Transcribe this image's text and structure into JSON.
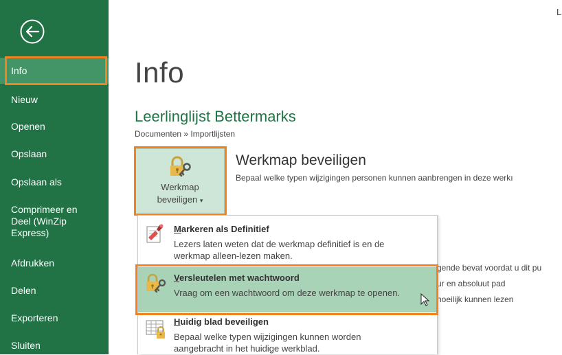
{
  "sidebar": {
    "items": [
      {
        "label": "Info"
      },
      {
        "label": "Nieuw"
      },
      {
        "label": "Openen"
      },
      {
        "label": "Opslaan"
      },
      {
        "label": "Opslaan als"
      },
      {
        "label": "Comprimeer en Deel (WinZip Express)"
      },
      {
        "label": "Afdrukken"
      },
      {
        "label": "Delen"
      },
      {
        "label": "Exporteren"
      },
      {
        "label": "Sluiten"
      }
    ]
  },
  "header": {
    "corner_letter": "L"
  },
  "main": {
    "title": "Info",
    "workbook_name": "Leerlinglijst Bettermarks",
    "breadcrumb": "Documenten » Importlijsten",
    "protect": {
      "button_line1": "Werkmap",
      "button_line2": "beveiligen",
      "button_caret": "▾",
      "section_title": "Werkmap beveiligen",
      "section_desc": "Bepaal welke typen wijzigingen personen kunnen aanbrengen in deze werkı"
    },
    "background_lines": [
      "gende bevat voordat u dit pu",
      "ur en absoluut pad",
      "noeilijk kunnen lezen"
    ]
  },
  "dropdown": {
    "items": [
      {
        "title_first": "M",
        "title_rest": "arkeren als Definitief",
        "desc": "Lezers laten weten dat de werkmap definitief is en de werkmap alleen-lezen maken."
      },
      {
        "title_first": "V",
        "title_rest": "ersleutelen met wachtwoord",
        "desc": "Vraag om een wachtwoord om deze werkmap te openen."
      },
      {
        "title_first": "H",
        "title_rest": "uidig blad beveiligen",
        "desc": "Bepaal welke typen wijzigingen kunnen worden aangebracht in het huidige werkblad."
      }
    ]
  },
  "colors": {
    "sidebar_bg": "#217346",
    "sidebar_active": "#439467",
    "accent_green": "#217346",
    "highlight_orange": "#f4831f",
    "menu_hover": "#a9d3b7"
  },
  "icons": {
    "back": "back-arrow-icon",
    "protect": "lock-key-icon",
    "mark_final": "mark-final-icon",
    "encrypt": "encrypt-password-icon",
    "protect_sheet": "protect-sheet-icon",
    "cursor": "mouse-cursor-icon"
  }
}
